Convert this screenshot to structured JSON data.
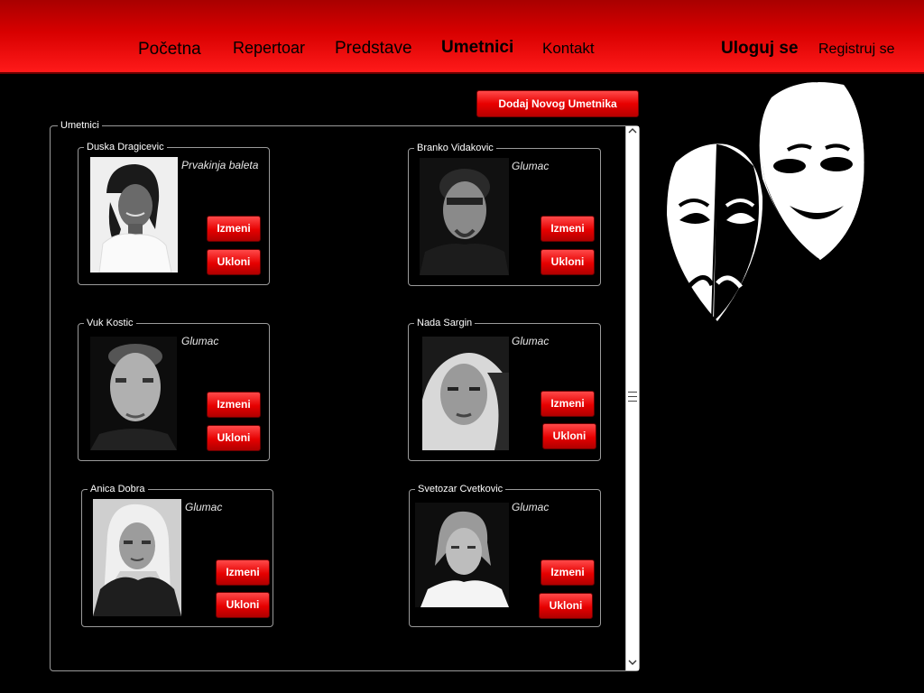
{
  "nav": {
    "home": "Početna",
    "repertoire": "Repertoar",
    "shows": "Predstave",
    "artists": "Umetnici",
    "contact": "Kontakt",
    "login": "Uloguj se",
    "register": "Registruj se"
  },
  "actions": {
    "add_artist": "Dodaj Novog Umetnika"
  },
  "panel": {
    "legend": "Umetnici"
  },
  "artists": [
    {
      "name": "Duska Dragicevic",
      "role": "Prvakinja baleta",
      "edit": "Izmeni",
      "remove": "Ukloni"
    },
    {
      "name": "Branko Vidakovic",
      "role": "Glumac",
      "edit": "Izmeni",
      "remove": "Ukloni"
    },
    {
      "name": "Vuk Kostic",
      "role": "Glumac",
      "edit": "Izmeni",
      "remove": "Ukloni"
    },
    {
      "name": "Nada Sargin",
      "role": "Glumac",
      "edit": "Izmeni",
      "remove": "Ukloni"
    },
    {
      "name": "Anica Dobra",
      "role": "Glumac",
      "edit": "Izmeni",
      "remove": "Ukloni"
    },
    {
      "name": "Svetozar Cvetkovic",
      "role": "Glumac",
      "edit": "Izmeni",
      "remove": "Ukloni"
    }
  ],
  "icons": {
    "scroll_up": "chevron-up-icon",
    "scroll_down": "chevron-down-icon",
    "logo": "theatre-masks-icon"
  },
  "colors": {
    "accent": "#e60000",
    "header_top": "#a80000",
    "header_bottom": "#ff1a1a",
    "background": "#000000"
  }
}
